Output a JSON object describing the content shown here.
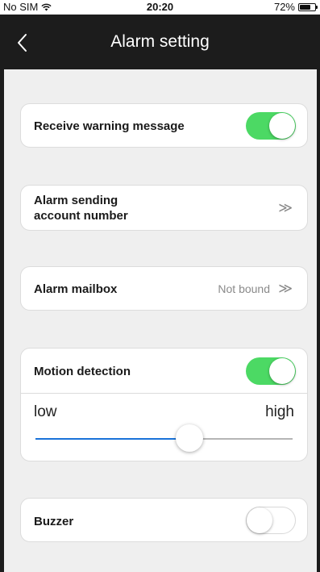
{
  "status_bar": {
    "carrier": "No SIM",
    "wifi_icon": "wifi-icon",
    "time": "20:20",
    "battery_text": "72%",
    "battery_level": 0.72
  },
  "nav": {
    "back_icon": "chevron-left-icon",
    "title": "Alarm setting"
  },
  "rows": {
    "receive_warning": {
      "label": "Receive warning message",
      "toggle_on": true
    },
    "alarm_account": {
      "label_line1": "Alarm sending",
      "label_line2": "account number",
      "chevron": "≫"
    },
    "alarm_mailbox": {
      "label": "Alarm mailbox",
      "value": "Not bound",
      "chevron": "≫"
    },
    "motion_detection": {
      "label": "Motion detection",
      "toggle_on": true,
      "sensitivity": {
        "low_label": "low",
        "high_label": "high",
        "level": 0.6
      }
    },
    "buzzer": {
      "label": "Buzzer",
      "toggle_on": false
    }
  },
  "colors": {
    "toggle_on": "#4cd964",
    "slider_fill": "#1a73d9",
    "nav_background": "#1c1c1c",
    "content_background": "#efefef"
  }
}
